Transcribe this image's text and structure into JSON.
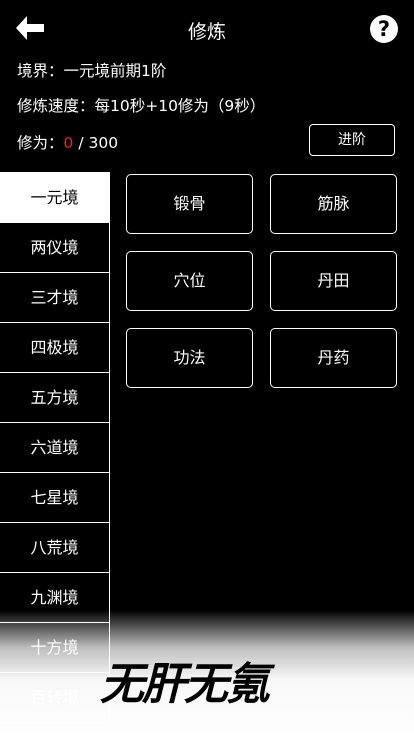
{
  "header": {
    "title": "修炼",
    "help_label": "?"
  },
  "status": {
    "realm_line": "境界：一元境前期1阶",
    "speed_line": "修炼速度：每10秒+10修为（9秒）",
    "cultivation_prefix": "修为：",
    "cultivation_current": "0",
    "cultivation_max": " / 300"
  },
  "actions": {
    "advance_label": "进阶"
  },
  "realms": [
    {
      "label": "一元境",
      "selected": true
    },
    {
      "label": "两仪境"
    },
    {
      "label": "三才境"
    },
    {
      "label": "四极境"
    },
    {
      "label": "五方境"
    },
    {
      "label": "六道境"
    },
    {
      "label": "七星境"
    },
    {
      "label": "八荒境"
    },
    {
      "label": "九渊境"
    },
    {
      "label": "十方境"
    },
    {
      "label": "百转境"
    }
  ],
  "skills": [
    {
      "label": "锻骨"
    },
    {
      "label": "筋脉"
    },
    {
      "label": "穴位"
    },
    {
      "label": "丹田"
    },
    {
      "label": "功法"
    },
    {
      "label": "丹药"
    }
  ],
  "watermark": "无肝无氪",
  "colors": {
    "background": "#000000",
    "foreground": "#ffffff",
    "cultivation_current": "#e0262b"
  },
  "icons": {
    "back": "arrow-left-icon",
    "help": "question-circle-icon"
  }
}
